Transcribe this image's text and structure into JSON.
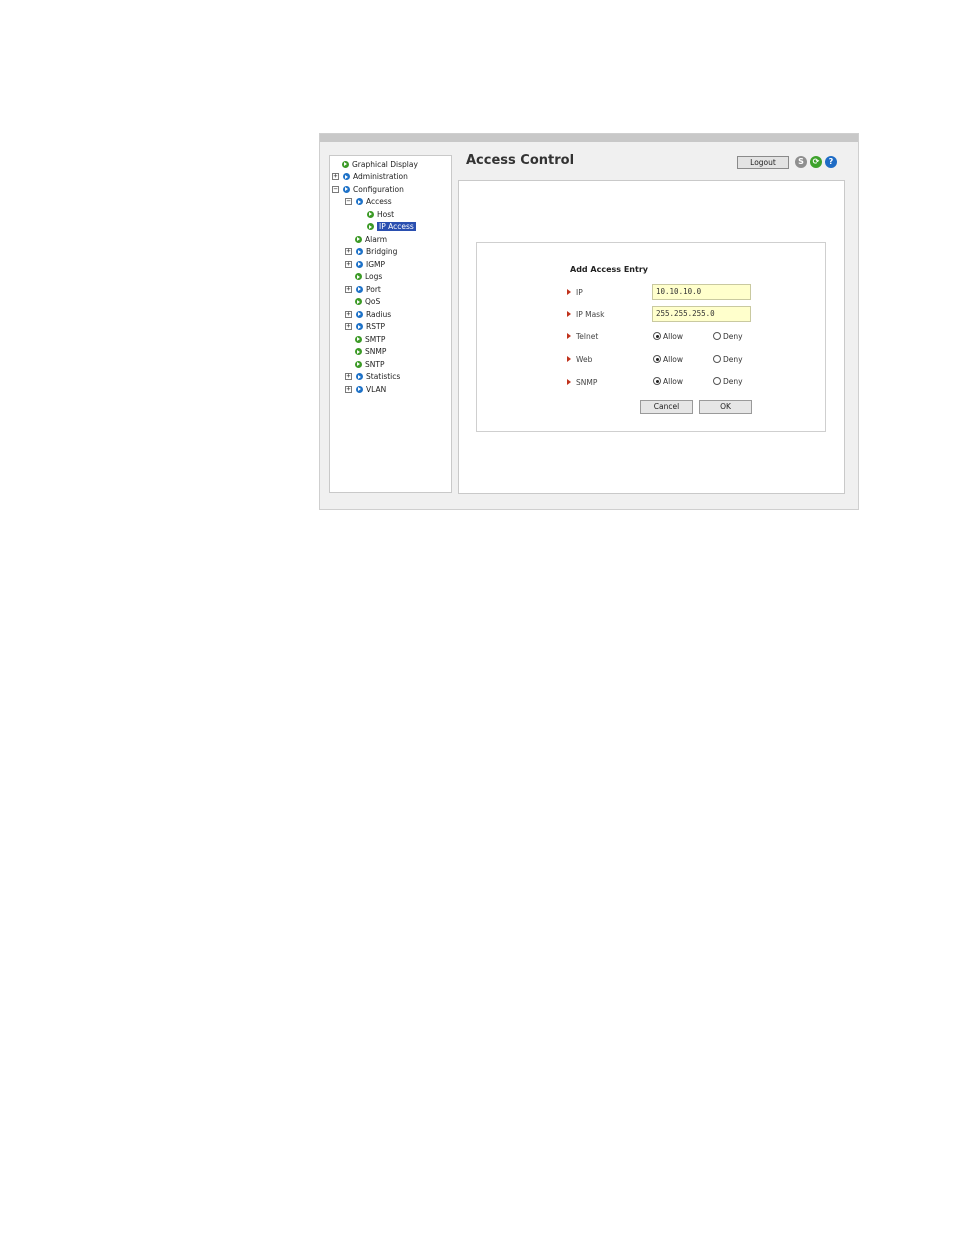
{
  "header": {
    "title": "Access Control",
    "logout_label": "Logout",
    "save_icon": "S",
    "refresh_icon": "⟳",
    "help_icon": "?"
  },
  "tree": {
    "items": [
      {
        "label": "Graphical Display"
      },
      {
        "label": "Administration",
        "expander": "+"
      },
      {
        "label": "Configuration",
        "expander": "−"
      },
      {
        "label": "Access",
        "expander": "−"
      },
      {
        "label": "Host"
      },
      {
        "label": "IP Access",
        "selected": true
      },
      {
        "label": "Alarm"
      },
      {
        "label": "Bridging",
        "expander": "+"
      },
      {
        "label": "IGMP",
        "expander": "+"
      },
      {
        "label": "Logs"
      },
      {
        "label": "Port",
        "expander": "+"
      },
      {
        "label": "QoS"
      },
      {
        "label": "Radius",
        "expander": "+"
      },
      {
        "label": "RSTP",
        "expander": "+"
      },
      {
        "label": "SMTP"
      },
      {
        "label": "SNMP"
      },
      {
        "label": "SNTP"
      },
      {
        "label": "Statistics",
        "expander": "+"
      },
      {
        "label": "VLAN",
        "expander": "+"
      }
    ]
  },
  "form": {
    "title": "Add Access Entry",
    "ip": {
      "label": "IP",
      "value": "10.10.10.0"
    },
    "ip_mask": {
      "label": "IP Mask",
      "value": "255.255.255.0"
    },
    "telnet": {
      "label": "Telnet",
      "allow": "Allow",
      "deny": "Deny",
      "selected": "Allow"
    },
    "web": {
      "label": "Web",
      "allow": "Allow",
      "deny": "Deny",
      "selected": "Allow"
    },
    "snmp": {
      "label": "SNMP",
      "allow": "Allow",
      "deny": "Deny",
      "selected": "Allow"
    },
    "cancel_label": "Cancel",
    "ok_label": "OK"
  },
  "colors": {
    "selection": "#2a4fb0",
    "input_bg": "#ffffcc",
    "arrow": "#c0321c"
  }
}
